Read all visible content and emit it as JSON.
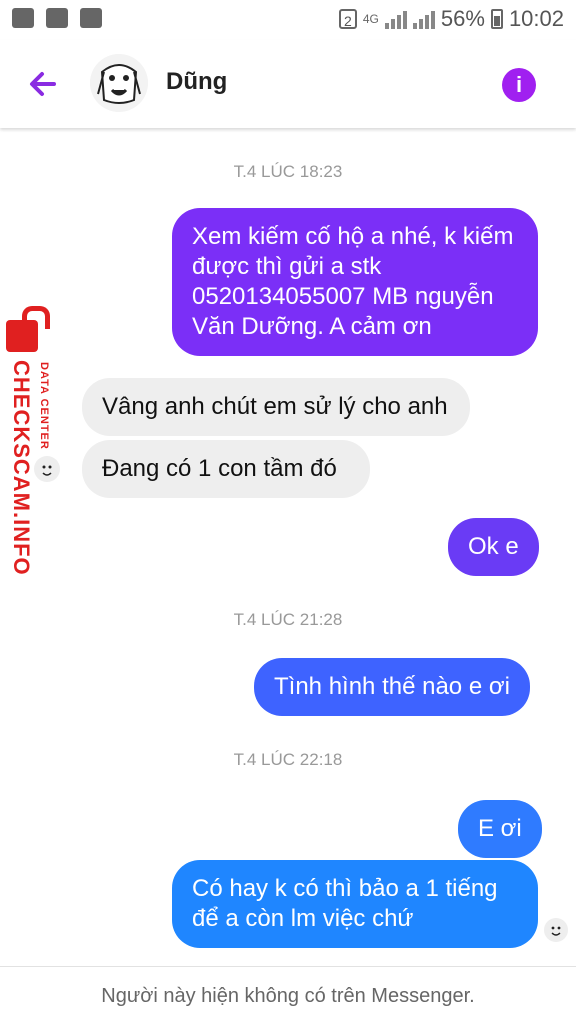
{
  "status_bar": {
    "sim_badge": "2",
    "network": "4G",
    "battery_percent": "56%",
    "time": "10:02"
  },
  "header": {
    "contact_name": "Dũng",
    "back_icon": "arrow-left-icon",
    "info_icon": "info-icon",
    "info_label": "i"
  },
  "colors": {
    "accent": "#8a2be2",
    "out_bubble_1": "#7b2ff7",
    "out_bubble_2": "#6a3bf5",
    "out_bubble_3": "#3e63ff",
    "out_bubble_4": "#2f7bff",
    "in_bubble": "#eeeeee",
    "watermark": "#e02020"
  },
  "messages": {
    "ts1": "T.4 LÚC 18:23",
    "m1": "Xem kiếm cố hộ a nhé, k kiếm được thì gửi a stk 0520134055007 MB nguyễn Văn Dưỡng. A cảm ơn",
    "m2": "Vâng anh chút em sử lý cho anh",
    "m3": "Đang có 1 con tầm đó",
    "m4": "Ok e",
    "ts2": "T.4 LÚC 21:28",
    "m5": "Tình hình thế nào e ơi",
    "ts3": "T.4 LÚC 22:18",
    "m6": "E ơi",
    "m7": "Có hay k có thì bảo a 1 tiếng để a còn lm việc chứ"
  },
  "watermark": {
    "brand": "CHECKSCAM.INFO",
    "tag": "DATA CENTER"
  },
  "footer": {
    "notice": "Người này hiện không có trên Messenger."
  }
}
